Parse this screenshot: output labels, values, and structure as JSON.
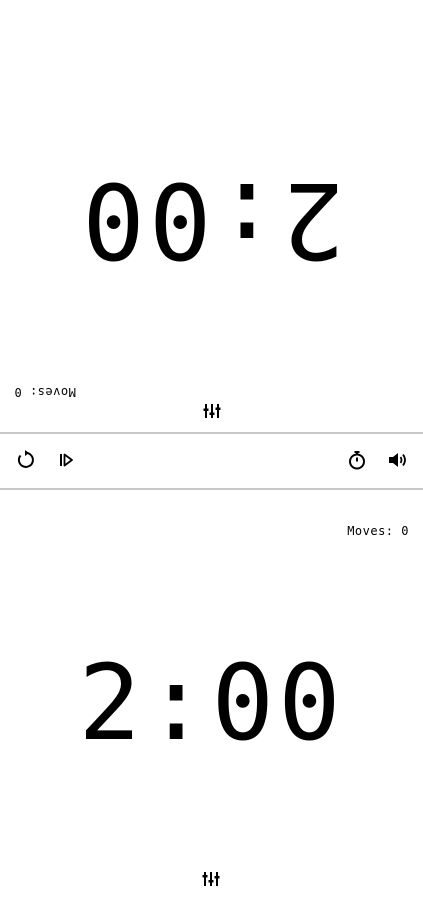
{
  "top_player": {
    "time": "2:00",
    "moves_label": "Moves: ",
    "moves_count": "0"
  },
  "bottom_player": {
    "time": "2:00",
    "moves_label": "Moves: ",
    "moves_count": "0"
  },
  "controls": {
    "reset_icon": "reset-icon",
    "play_icon": "play-icon",
    "timer_icon": "stopwatch-icon",
    "sound_icon": "speaker-icon"
  },
  "colors": {
    "text": "#000000",
    "background": "#ffffff",
    "divider": "#c8c8c8"
  }
}
